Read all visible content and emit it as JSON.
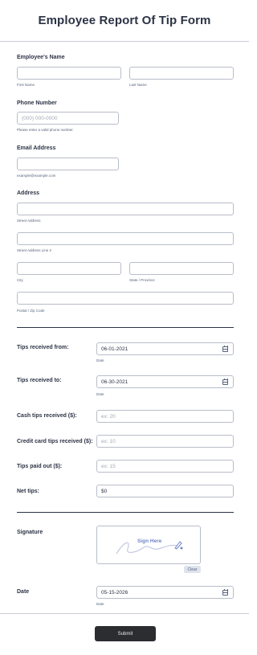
{
  "form": {
    "title": "Employee Report Of Tip Form"
  },
  "employee_name": {
    "label": "Employee's Name",
    "first_sublabel": "First Name",
    "last_sublabel": "Last Name"
  },
  "phone": {
    "label": "Phone Number",
    "placeholder": "(000) 000-0000",
    "sublabel": "Please enter a valid phone number."
  },
  "email": {
    "label": "Email Address",
    "sublabel": "example@example.com"
  },
  "address": {
    "label": "Address",
    "street_sublabel": "Street Address",
    "street2_sublabel": "Street Address Line 2",
    "city_sublabel": "City",
    "state_sublabel": "State / Province",
    "zip_sublabel": "Postal / Zip Code"
  },
  "tips_from": {
    "label": "Tips received from:",
    "value": "06-01-2021",
    "sublabel": "Date"
  },
  "tips_to": {
    "label": "Tips received to:",
    "value": "06-30-2021",
    "sublabel": "Date"
  },
  "cash_tips": {
    "label": "Cash tips received ($):",
    "placeholder": "ex: 20"
  },
  "credit_tips": {
    "label": "Credit card tips received ($):",
    "placeholder": "ex: 10"
  },
  "tips_paid": {
    "label": "Tips paid out ($):",
    "placeholder": "ex: 15"
  },
  "net_tips": {
    "label": "Net tips:",
    "value": "$0"
  },
  "signature": {
    "label": "Signature",
    "prompt": "Sign Here",
    "clear_label": "Clear"
  },
  "date": {
    "label": "Date",
    "value": "05-15-2026",
    "sublabel": "Date"
  },
  "footer": {
    "submit_label": "Submit"
  },
  "colors": {
    "accent": "#2b2d31",
    "text": "#2c3345",
    "border": "#b8bdc9"
  }
}
